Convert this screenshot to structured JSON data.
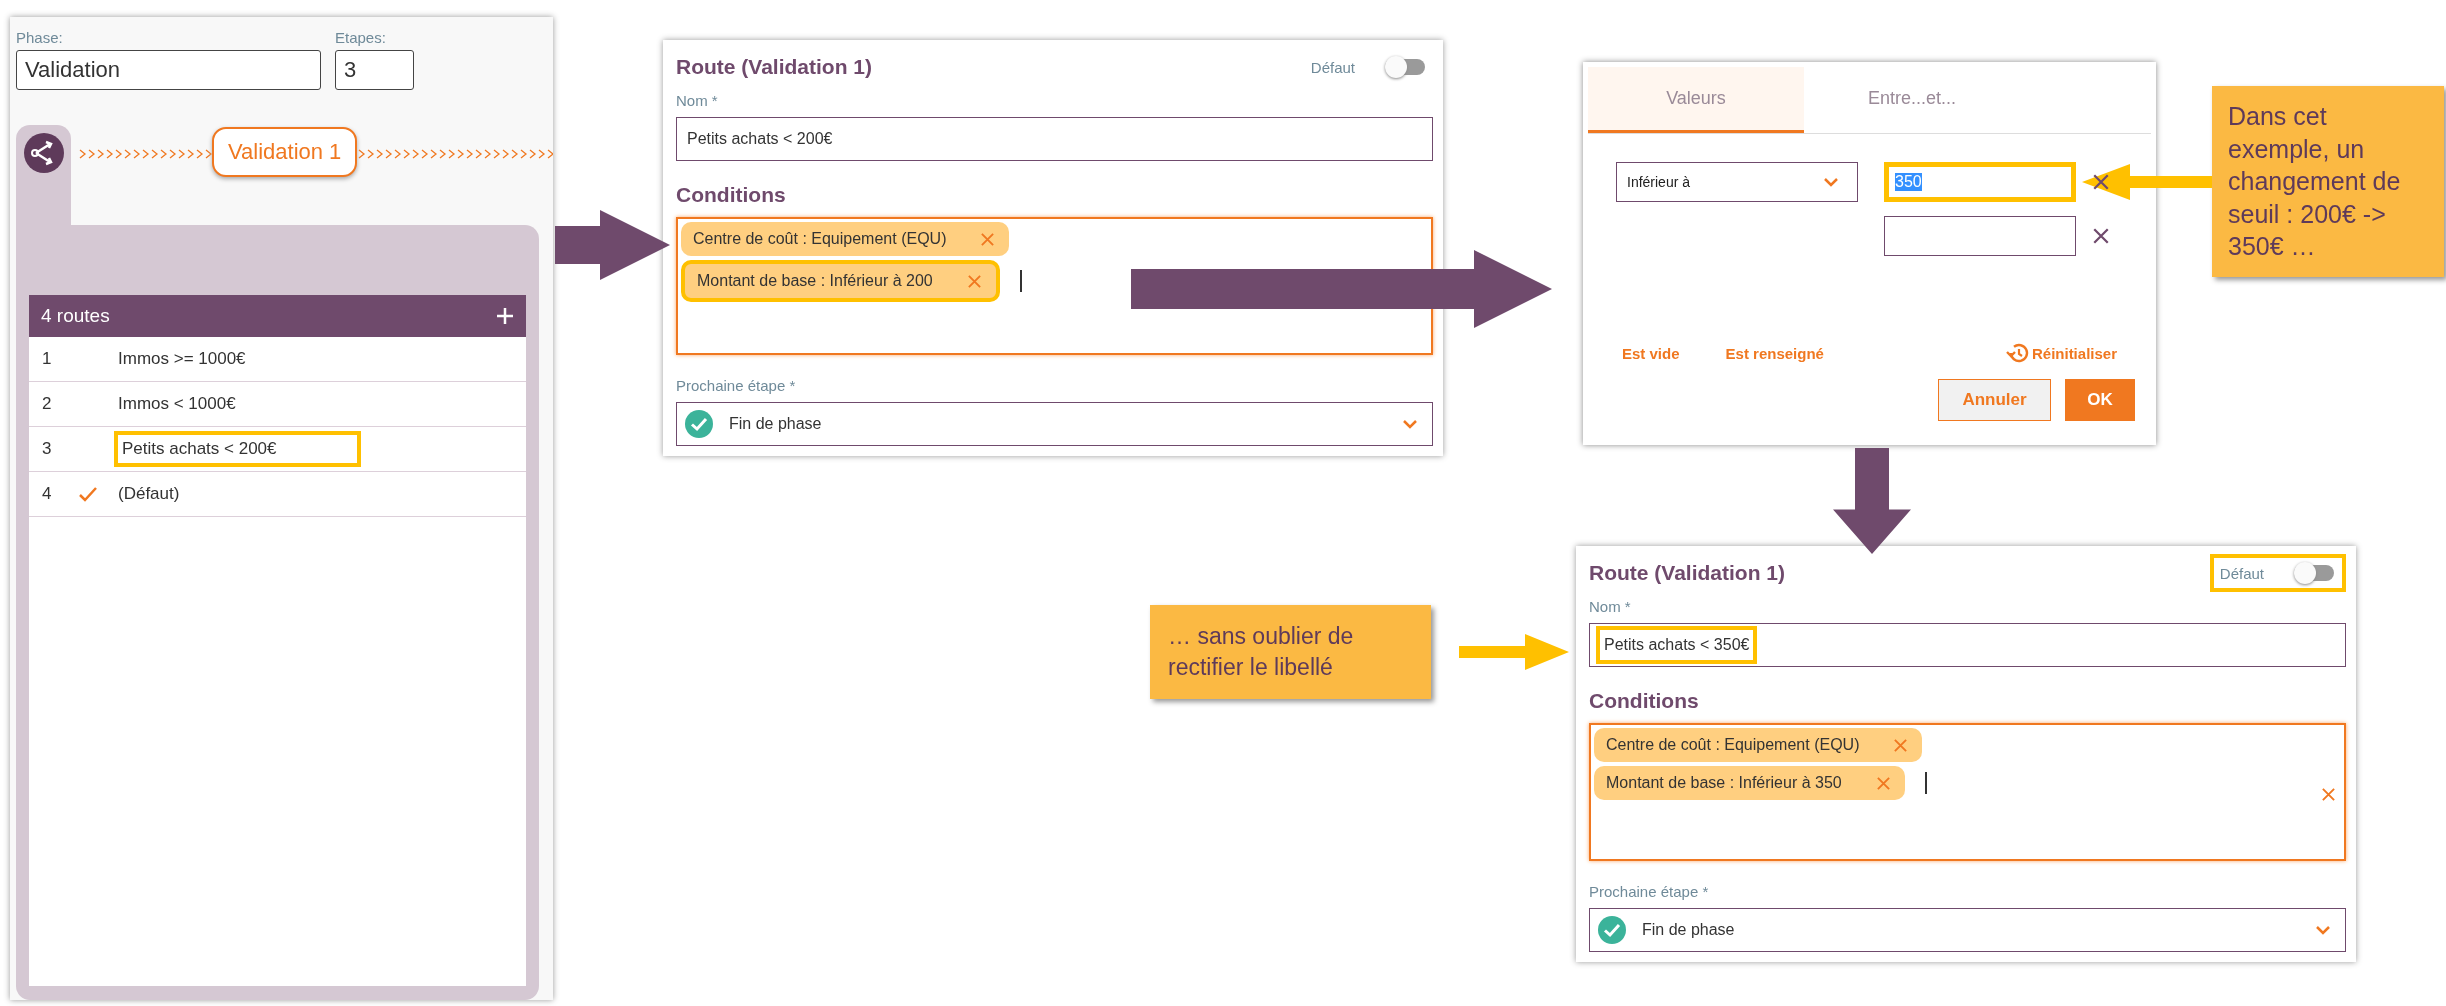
{
  "phase_panel": {
    "phase_label": "Phase:",
    "phase_value": "Validation",
    "steps_label": "Etapes:",
    "steps_value": "3",
    "step_node": "Validation 1",
    "routes_table": {
      "title": "4 routes",
      "rows": [
        {
          "number": "1",
          "name": "Immos >= 1000€",
          "default": false,
          "highlighted": false
        },
        {
          "number": "2",
          "name": "Immos < 1000€",
          "default": false,
          "highlighted": false
        },
        {
          "number": "3",
          "name": "Petits achats < 200€",
          "default": false,
          "highlighted": true
        },
        {
          "number": "4",
          "name": "(Défaut)",
          "default": true,
          "highlighted": false
        }
      ]
    }
  },
  "route_editor": {
    "title": "Route (Validation 1)",
    "default_label": "Défaut",
    "default_on": false,
    "default_highlighted": false,
    "name_label": "Nom *",
    "name_value": "Petits achats < 200€",
    "name_highlighted": false,
    "conditions_title": "Conditions",
    "conditions": [
      {
        "text": "Centre de coût : Equipement (EQU)",
        "highlighted": false
      },
      {
        "text": "Montant de base : Inférieur à 200",
        "highlighted": true
      }
    ],
    "next_step_label": "Prochaine étape *",
    "next_step_value": "Fin de phase"
  },
  "condition_dialog": {
    "tabs": [
      {
        "label": "Valeurs",
        "selected": true
      },
      {
        "label": "Entre...et...",
        "selected": false
      }
    ],
    "operator": "Inférieur à",
    "values": [
      {
        "value": "350",
        "text_selected": true,
        "highlighted": true
      },
      {
        "highlighted": false
      }
    ],
    "links": [
      "Est vide",
      "Est renseigné"
    ],
    "reset_link": "Réinitialiser",
    "cancel_button": "Annuler",
    "ok_button": "OK"
  },
  "callouts": [
    {
      "text": "Dans cet exemple, un changement de seuil : 200€ -> 350€ …"
    },
    {
      "text": "… sans oublier de rectifier le libellé"
    }
  ],
  "updated_route_editor": {
    "title": "Route (Validation 1)",
    "default_label": "Défaut",
    "default_on": false,
    "default_highlighted": true,
    "name_label": "Nom *",
    "name_value": "Petits achats < 350€",
    "name_highlighted": true,
    "conditions_title": "Conditions",
    "conditions": [
      {
        "text": "Centre de coût : Equipement (EQU)",
        "highlighted": false
      },
      {
        "text": "Montant de base : Inférieur à 350",
        "highlighted": false
      }
    ],
    "clear_all": true,
    "next_step_label": "Prochaine étape *",
    "next_step_value": "Fin de phase"
  }
}
